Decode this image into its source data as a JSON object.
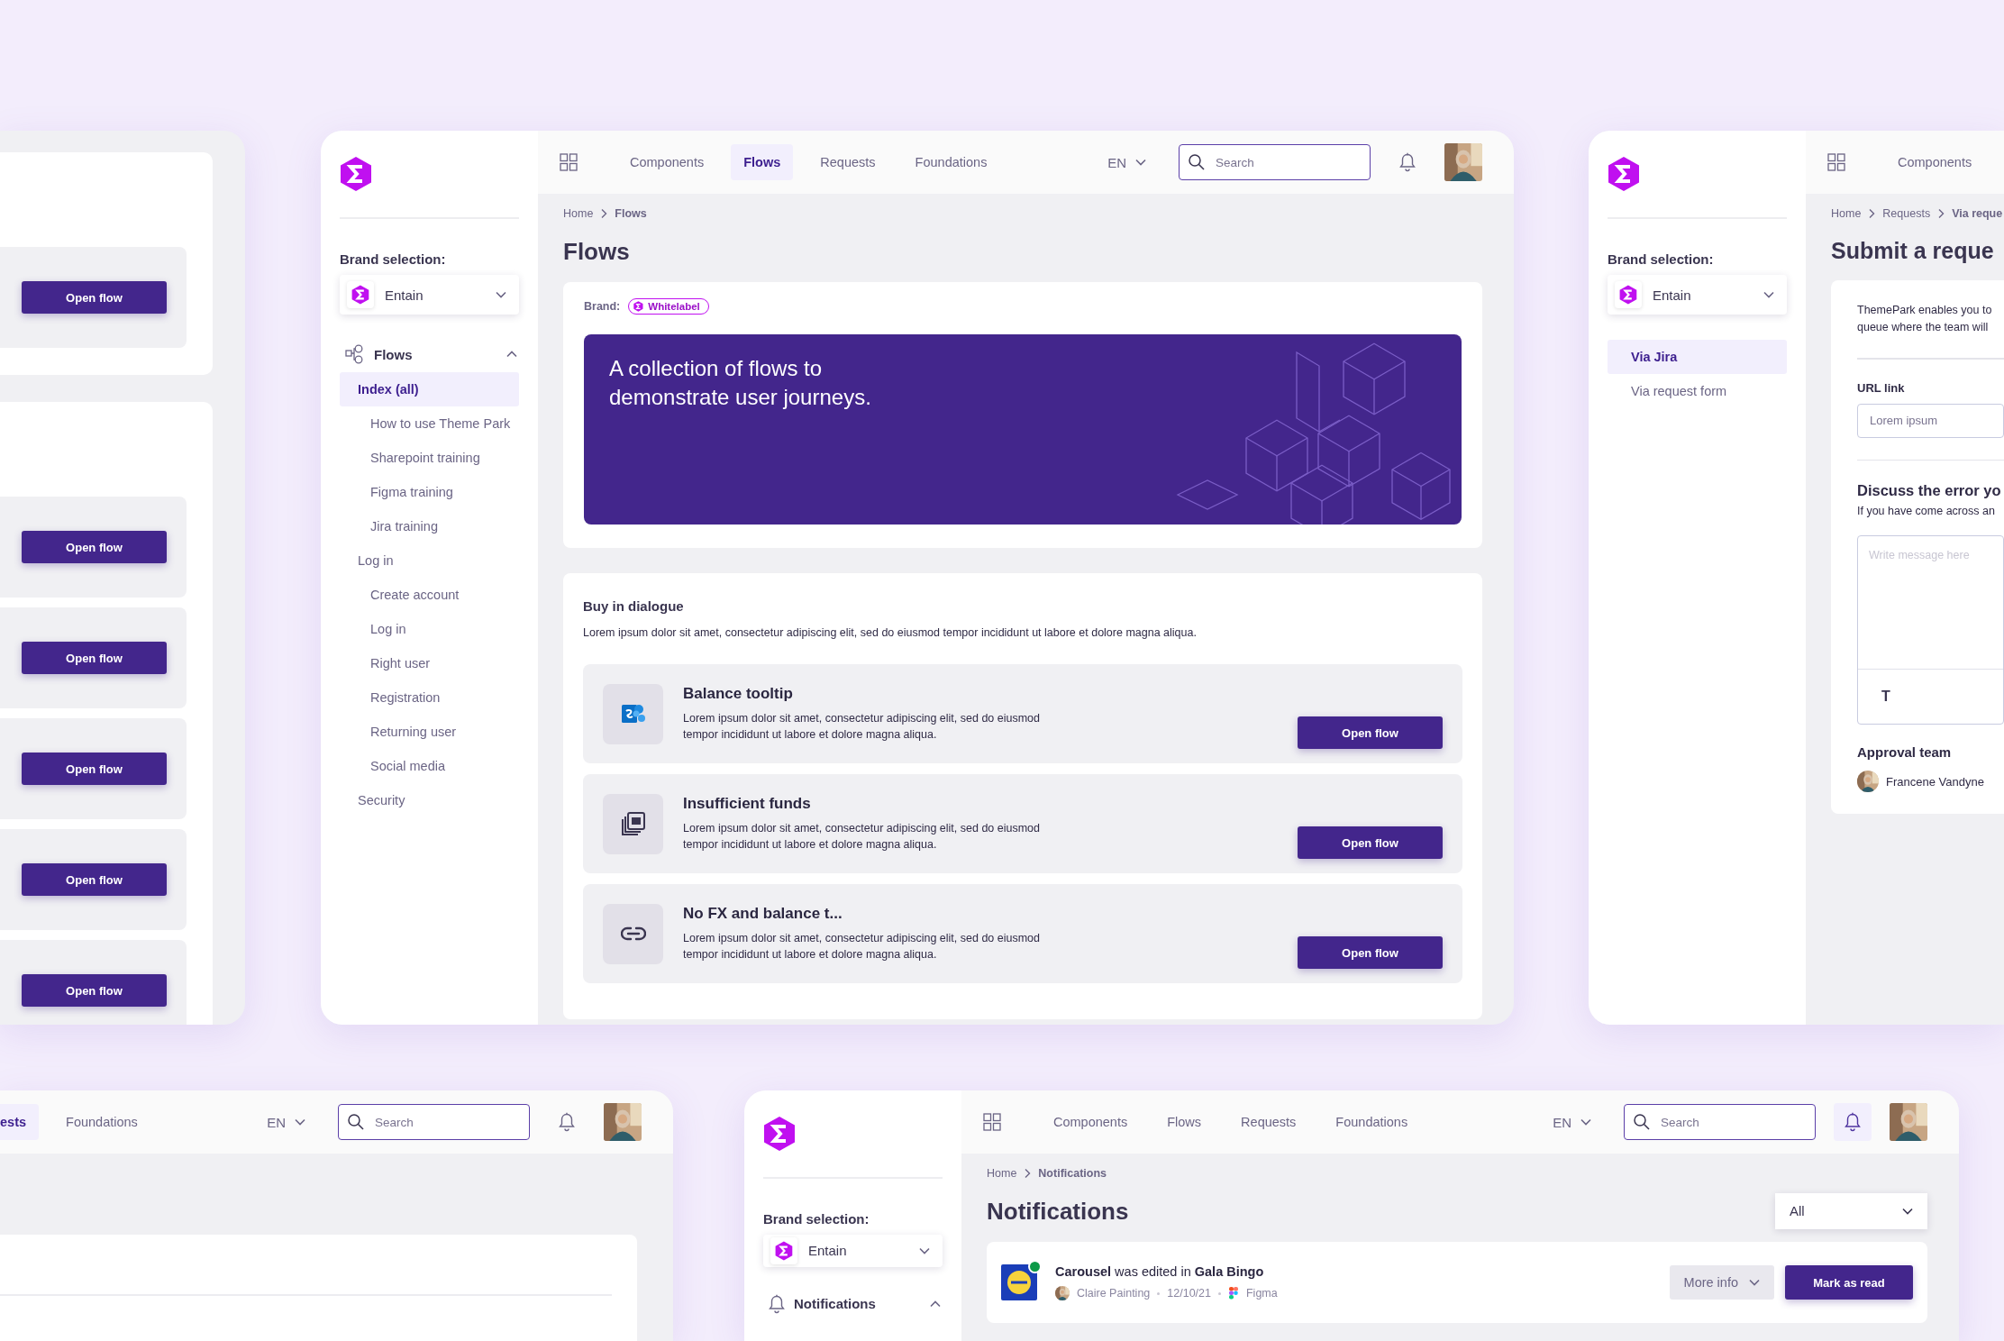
{
  "left_window": {
    "flows": [
      {
        "button": "Open flow"
      },
      {
        "button": "Open flow"
      },
      {
        "button": "Open flow"
      },
      {
        "button": "Open flow"
      },
      {
        "button": "Open flow"
      },
      {
        "button": "Open flow"
      }
    ]
  },
  "main_window": {
    "sidebar": {
      "brand_label": "Brand selection:",
      "brand": "Entain",
      "nav": {
        "title": "Flows",
        "expanded": true,
        "items": [
          {
            "label": "Index (all)",
            "selected": true,
            "children": [
              {
                "label": "How to use Theme Park",
                "selected": false
              },
              {
                "label": "Sharepoint training",
                "selected": false
              },
              {
                "label": "Figma training",
                "selected": false
              },
              {
                "label": "Jira training",
                "selected": false
              }
            ]
          },
          {
            "label": "Log in",
            "selected": false,
            "children": [
              {
                "label": "Create account",
                "selected": false
              },
              {
                "label": "Log in",
                "selected": false
              },
              {
                "label": "Right user",
                "selected": false
              },
              {
                "label": "Registration",
                "selected": false
              },
              {
                "label": "Returning user",
                "selected": false
              },
              {
                "label": "Social media",
                "selected": false
              }
            ]
          },
          {
            "label": "Security",
            "selected": false
          }
        ]
      }
    },
    "topbar": {
      "tabs": [
        {
          "label": "Components",
          "selected": false
        },
        {
          "label": "Flows",
          "selected": true
        },
        {
          "label": "Requests",
          "selected": false
        },
        {
          "label": "Foundations",
          "selected": false
        }
      ],
      "language": "EN",
      "search": {
        "placeholder": "Search"
      },
      "bell_active": false
    },
    "breadcrumb": [
      "Home",
      "Flows"
    ],
    "title": "Flows",
    "brand_card": {
      "label": "Brand:",
      "tag": "Whitelabel",
      "banner": "A collection of flows to demonstrate user journeys."
    },
    "section": {
      "title": "Buy in dialogue",
      "description": "Lorem ipsum dolor sit amet, consectetur adipiscing elit, sed do eiusmod tempor incididunt ut labore et dolore magna aliqua.",
      "flows": [
        {
          "title": "Balance tooltip",
          "description": "Lorem ipsum dolor sit amet, consectetur adipiscing elit, sed do eiusmod tempor incididunt ut labore et dolore magna aliqua.",
          "button": "Open flow"
        },
        {
          "title": "Insufficient funds",
          "description": "Lorem ipsum dolor sit amet, consectetur adipiscing elit, sed do eiusmod tempor incididunt ut labore et dolore magna aliqua.",
          "button": "Open flow"
        },
        {
          "title": "No FX and balance t...",
          "description": "Lorem ipsum dolor sit amet, consectetur adipiscing elit, sed do eiusmod tempor incididunt ut labore et dolore magna aliqua.",
          "button": "Open flow"
        }
      ]
    }
  },
  "right_window": {
    "sidebar": {
      "brand_label": "Brand selection:",
      "brand": "Entain",
      "nav": {
        "items": [
          {
            "label": "Via Jira",
            "selected": true
          },
          {
            "label": "Via request form",
            "selected": false
          }
        ]
      }
    },
    "topbar": {
      "tabs": [
        {
          "label": "Components",
          "selected": false
        }
      ]
    },
    "breadcrumb": [
      "Home",
      "Requests",
      "Via reque"
    ],
    "title": "Submit a reque",
    "intro": [
      "ThemePark enables you to",
      "queue where the team will"
    ],
    "url_label": "URL link",
    "url_field": {
      "placeholder": "Lorem ipsum"
    },
    "discuss_title": "Discuss the error yo",
    "discuss_text": "If you have come across an",
    "message": {
      "placeholder": "Write message here",
      "toolbar": "T"
    },
    "approval_title": "Approval team",
    "approvers": [
      {
        "name": "Francene Vandyne"
      }
    ]
  },
  "bottom_left_window": {
    "topbar": {
      "tabs": [
        {
          "label": "ests",
          "selected": true
        },
        {
          "label": "Foundations",
          "selected": false
        }
      ],
      "language": "EN",
      "search": {
        "placeholder": "Search"
      },
      "bell_active": false
    }
  },
  "bottom_right_window": {
    "sidebar": {
      "brand_label": "Brand selection:",
      "brand": "Entain",
      "nav": {
        "title": "Notifications",
        "expanded": true
      }
    },
    "topbar": {
      "tabs": [
        {
          "label": "Components",
          "selected": false
        },
        {
          "label": "Flows",
          "selected": false
        },
        {
          "label": "Requests",
          "selected": false
        },
        {
          "label": "Foundations",
          "selected": false
        }
      ],
      "language": "EN",
      "search": {
        "placeholder": "Search"
      },
      "bell_active": true
    },
    "breadcrumb": [
      "Home",
      "Notifications"
    ],
    "title": "Notifications",
    "filter": "All",
    "notifications": [
      {
        "unread": true,
        "text": "**Carousel** was edited in **Gala Bingo**",
        "author": "Claire Painting",
        "date": "12/10/21",
        "source": "Figma",
        "more": "More info",
        "action": "Mark as read"
      }
    ]
  }
}
